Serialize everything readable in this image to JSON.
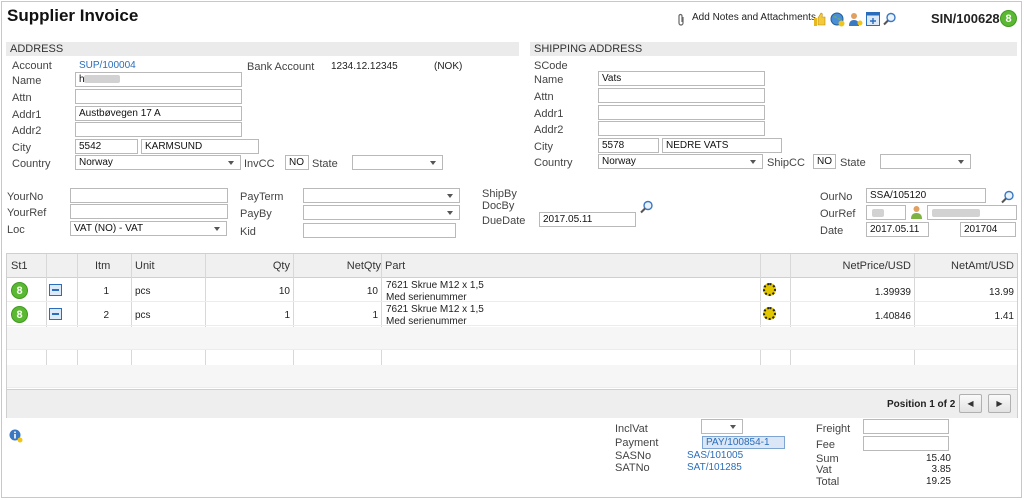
{
  "header": {
    "title": "Supplier Invoice",
    "notes_label": "Add Notes and Attachments",
    "doc_no": "SIN/100628",
    "status": "8"
  },
  "address": {
    "title": "ADDRESS",
    "account_label": "Account",
    "account": "SUP/100004",
    "name_label": "Name",
    "name": "h",
    "attn_label": "Attn",
    "addr1_label": "Addr1",
    "addr1": "Austbøvegen 17 A",
    "addr2_label": "Addr2",
    "city_label": "City",
    "zip": "5542",
    "city": "KARMSUND",
    "country_label": "Country",
    "country": "Norway",
    "bank_label": "Bank Account",
    "bank": "1234.12.12345",
    "currency": "(NOK)",
    "invcc_label": "InvCC",
    "invcc": "NO",
    "state_label": "State"
  },
  "shipping": {
    "title": "SHIPPING ADDRESS",
    "scode_label": "SCode",
    "name_label": "Name",
    "name": "Vats",
    "attn_label": "Attn",
    "addr1_label": "Addr1",
    "addr2_label": "Addr2",
    "city_label": "City",
    "zip": "5578",
    "city": "NEDRE VATS",
    "country_label": "Country",
    "country": "Norway",
    "shipcc_label": "ShipCC",
    "shipcc": "NO",
    "state_label": "State"
  },
  "mid": {
    "yourno_label": "YourNo",
    "yourref_label": "YourRef",
    "loc_label": "Loc",
    "loc": "VAT (NO) - VAT",
    "payterm_label": "PayTerm",
    "payby_label": "PayBy",
    "kid_label": "Kid",
    "shipby_label": "ShipBy",
    "docby_label": "DocBy",
    "duedate_label": "DueDate",
    "duedate": "2017.05.11",
    "ourno_label": "OurNo",
    "ourno": "SSA/105120",
    "ourref_label": "OurRef",
    "date_label": "Date",
    "date": "2017.05.11",
    "period": "201704"
  },
  "grid": {
    "headers": {
      "st1": "St1",
      "itm": "Itm",
      "unit": "Unit",
      "qty": "Qty",
      "netqty": "NetQty",
      "part": "Part",
      "netprice": "NetPrice/USD",
      "netamt": "NetAmt/USD"
    },
    "rows": [
      {
        "status": "8",
        "itm": "1",
        "unit": "pcs",
        "qty": "10",
        "netqty": "10",
        "part": "7621 Skrue M12 x 1,5",
        "note": "Med serienummer",
        "netprice": "1.39939",
        "netamt": "13.99"
      },
      {
        "status": "8",
        "itm": "2",
        "unit": "pcs",
        "qty": "1",
        "netqty": "1",
        "part": "7621 Skrue M12 x 1,5",
        "note": "Med serienummer",
        "netprice": "1.40846",
        "netamt": "1.41"
      }
    ],
    "position": "Position 1 of 2",
    "prev": "◀",
    "next": "▶"
  },
  "totals": {
    "inclvat_label": "InclVat",
    "payment_label": "Payment",
    "payment": "PAY/100854-1",
    "sasno_label": "SASNo",
    "sasno": "SAS/101005",
    "satno_label": "SATNo",
    "satno": "SAT/101285",
    "freight_label": "Freight",
    "fee_label": "Fee",
    "sum_label": "Sum",
    "sum": "15.40",
    "vat_label": "Vat",
    "vat": "3.85",
    "total_label": "Total",
    "total": "19.25"
  },
  "icons": [
    "paperclip-icon",
    "thumbs-up-icon",
    "globe-icon",
    "user-icon",
    "window-icon",
    "search-icon",
    "info-icon",
    "gear-icon",
    "line-details-icon"
  ],
  "colors": {
    "badge": "#5bb832",
    "link": "#2a6ebb",
    "section": "#ebebeb"
  }
}
